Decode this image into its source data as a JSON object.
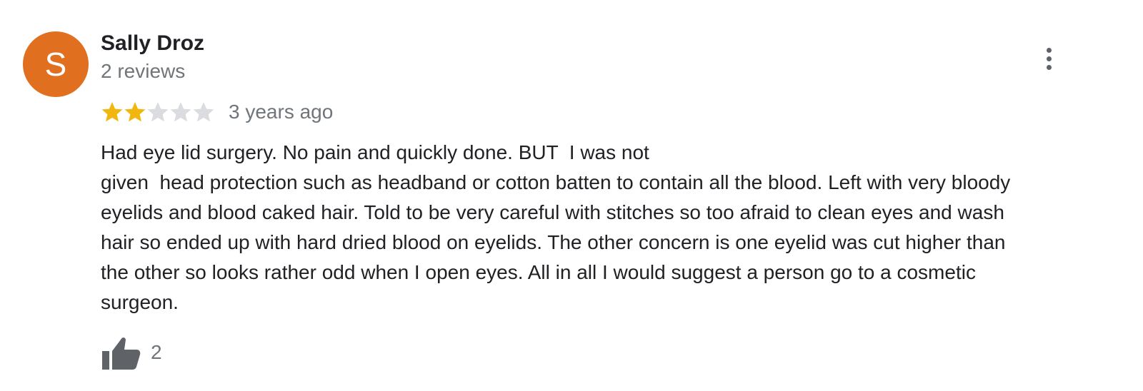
{
  "reviewer": {
    "initial": "S",
    "avatar_color": "#e0701f",
    "name": "Sally Droz",
    "review_count": "2 reviews"
  },
  "menu_icon": "more-vert-icon",
  "rating": {
    "value": 2,
    "max": 5,
    "filled_color": "#f2b70f",
    "empty_color": "#dadce0"
  },
  "time_ago": "3 years ago",
  "review_lines": [
    "Had eye lid surgery. No pain and quickly done. BUT  I was not",
    "given  head protection such as headband or cotton batten to contain all the blood. Left with very bloody",
    "eyelids and blood caked hair. Told to be very careful with stitches so too afraid to clean eyes and wash",
    "hair so ended up with hard dried blood on eyelids. The other concern is one eyelid was cut higher than",
    "the other so looks rather odd when I open eyes. All in all I would suggest a person go to a cosmetic",
    "surgeon."
  ],
  "like": {
    "icon": "thumbs-up-icon",
    "count": "2"
  }
}
